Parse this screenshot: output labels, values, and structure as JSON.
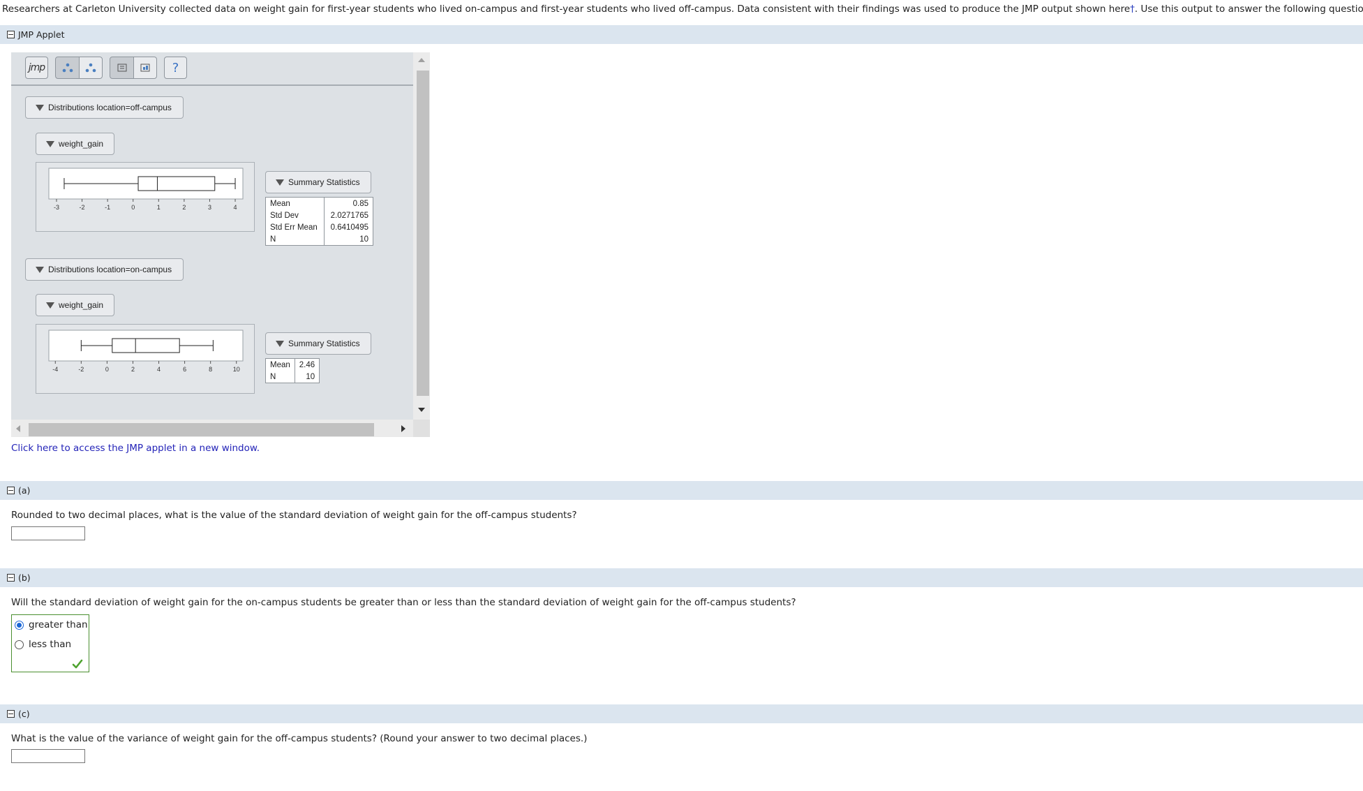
{
  "intro": {
    "text": "Researchers at Carleton University collected data on weight gain for first-year students who lived on-campus and first-year students who lived off-campus. Data consistent with their findings was used to produce the JMP output shown here",
    "dagger": "†",
    "tail": ". Use this output to answer the following questions."
  },
  "applet_section": {
    "label": "JMP Applet"
  },
  "toolbar": {
    "jmp_label": "jmp",
    "help_label": "?"
  },
  "groups": [
    {
      "header": "Distributions location=off-campus",
      "variable": "weight_gain",
      "stats_title": "Summary Statistics",
      "stats": [
        {
          "label": "Mean",
          "value": "0.85"
        },
        {
          "label": "Std Dev",
          "value": "2.0271765"
        },
        {
          "label": "Std Err Mean",
          "value": "0.6410495"
        },
        {
          "label": "N",
          "value": "10"
        }
      ],
      "axis_ticks": [
        "-3",
        "-2",
        "-1",
        "0",
        "1",
        "2",
        "3",
        "4"
      ]
    },
    {
      "header": "Distributions location=on-campus",
      "variable": "weight_gain",
      "stats_title": "Summary Statistics",
      "stats": [
        {
          "label": "Mean",
          "value": "2.46"
        },
        {
          "label": "N",
          "value": "10"
        }
      ],
      "axis_ticks": [
        "-4",
        "-2",
        "0",
        "2",
        "4",
        "6",
        "8",
        "10"
      ]
    }
  ],
  "chart_data": [
    {
      "type": "box",
      "axis_range": [
        -3.3,
        4.3
      ],
      "ticks": [
        -3,
        -2,
        -1,
        0,
        1,
        2,
        3,
        4
      ],
      "whisker_low": -2.7,
      "q1": 0.2,
      "median": 0.95,
      "q3": 3.2,
      "whisker_high": 4.0
    },
    {
      "type": "box",
      "axis_range": [
        -4.5,
        10.5
      ],
      "ticks": [
        -4,
        -2,
        0,
        2,
        4,
        6,
        8,
        10
      ],
      "whisker_low": -2.0,
      "q1": 0.4,
      "median": 2.2,
      "q3": 5.6,
      "whisker_high": 8.2
    }
  ],
  "link_text": "Click here to access the JMP applet in a new window.",
  "part_a": {
    "label": "(a)",
    "question": "Rounded to two decimal places, what is the value of the standard deviation of weight gain for the off-campus students?",
    "answer": ""
  },
  "part_b": {
    "label": "(b)",
    "question": "Will the standard deviation of weight gain for the on-campus students be greater than or less than the standard deviation of weight gain for the off-campus students?",
    "options": [
      "greater than",
      "less than"
    ],
    "selected": "greater than"
  },
  "part_c": {
    "label": "(c)",
    "question": "What is the value of the variance of weight gain for the off-campus students? (Round your answer to two decimal places.)",
    "answer": ""
  },
  "colors": {
    "section_bar": "#dbe5ef",
    "link": "#2323b8",
    "correct": "#4a8f2f",
    "radio": "#1a66d6"
  }
}
